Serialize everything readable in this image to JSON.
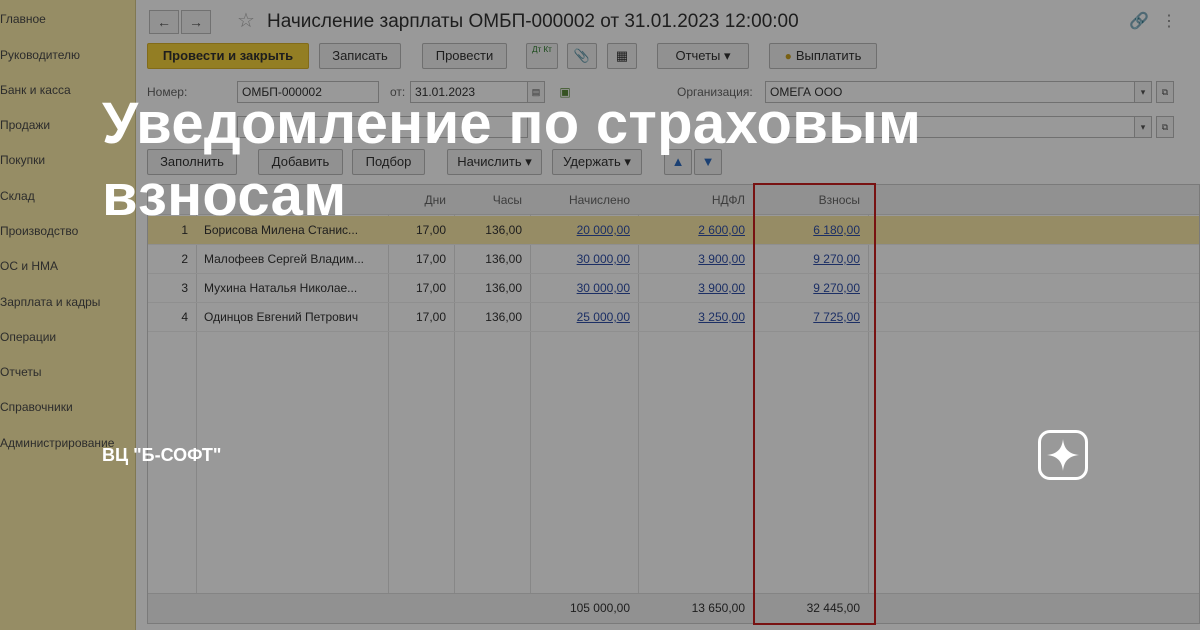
{
  "sidebar": {
    "items": [
      "Главное",
      "Руководителю",
      "Банк и касса",
      "Продажи",
      "Покупки",
      "Склад",
      "Производство",
      "ОС и НМА",
      "Зарплата и кадры",
      "Операции",
      "Отчеты",
      "Справочники",
      "Администрирование"
    ]
  },
  "document": {
    "title": "Начисление зарплаты ОМБП-000002 от 31.01.2023 12:00:00",
    "nav_back": "←",
    "nav_forward": "→"
  },
  "toolbar": {
    "post_and_close": "Провести и закрыть",
    "save": "Записать",
    "post": "Провести",
    "dt_kt": "Дт Кт",
    "reports": "Отчеты",
    "pay": "Выплатить"
  },
  "fields": {
    "number_label": "Номер:",
    "number_value": "ОМБП-000002",
    "date_label": "от:",
    "date_value": "31.01.2023",
    "org_label": "Организация:",
    "org_value": "ОМЕГА ООО"
  },
  "table_toolbar": {
    "fill": "Заполнить",
    "add": "Добавить",
    "pick": "Подбор",
    "accrue": "Начислить",
    "withhold": "Удержать"
  },
  "table": {
    "headers": {
      "days": "Дни",
      "hours": "Часы",
      "accrued": "Начислено",
      "ndfl": "НДФЛ",
      "contributions": "Взносы"
    },
    "rows": [
      {
        "n": "1",
        "employee": "Борисова Милена Станис...",
        "days": "17,00",
        "hours": "136,00",
        "accrued": "20 000,00",
        "ndfl": "2 600,00",
        "contributions": "6 180,00"
      },
      {
        "n": "2",
        "employee": "Малофеев Сергей Владим...",
        "days": "17,00",
        "hours": "136,00",
        "accrued": "30 000,00",
        "ndfl": "3 900,00",
        "contributions": "9 270,00"
      },
      {
        "n": "3",
        "employee": "Мухина Наталья Николае...",
        "days": "17,00",
        "hours": "136,00",
        "accrued": "30 000,00",
        "ndfl": "3 900,00",
        "contributions": "9 270,00"
      },
      {
        "n": "4",
        "employee": "Одинцов Евгений Петрович",
        "days": "17,00",
        "hours": "136,00",
        "accrued": "25 000,00",
        "ndfl": "3 250,00",
        "contributions": "7 725,00"
      }
    ],
    "totals": {
      "accrued": "105 000,00",
      "ndfl": "13 650,00",
      "contributions": "32 445,00"
    }
  },
  "overlay": {
    "headline": "Уведомление по страховым взносам",
    "channel": "ВЦ \"Б-СОФТ\""
  },
  "colors": {
    "sidebar_bg": "#fbeca8",
    "primary_button": "#f6d23d",
    "selected_row": "#fbe9a9",
    "highlight_border": "#c81e1e",
    "link": "#2f4fa8"
  }
}
